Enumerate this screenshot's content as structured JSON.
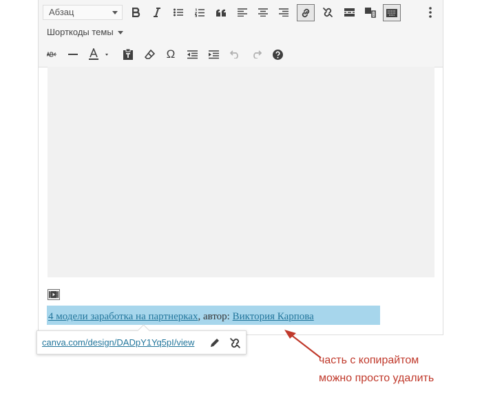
{
  "toolbar": {
    "format_select": "Абзац",
    "shortcodes_label": "Шорткоды темы"
  },
  "caption": {
    "link_text": "4 модели заработка на партнерках",
    "middle_text": ", автор: ",
    "author_text": "Виктория Карпова"
  },
  "link_popup": {
    "url": "canva.com/design/DADpY1Yq5pI/view"
  },
  "annotation": {
    "line1": "часть с копирайтом",
    "line2": "можно просто удалить",
    "color": "#c0392b"
  },
  "colors": {
    "accent": "#21759b",
    "highlight": "#a7d6ec",
    "toolbar_bg": "#f5f5f5"
  }
}
